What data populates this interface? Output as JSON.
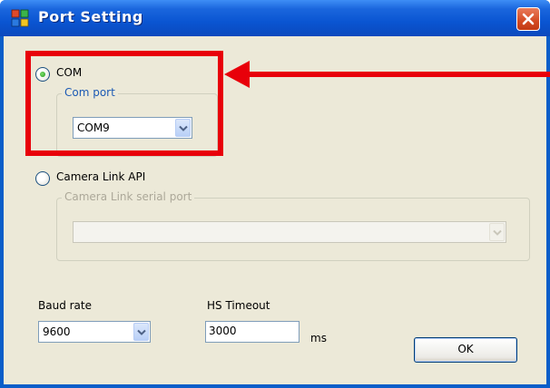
{
  "window": {
    "title": "Port Setting"
  },
  "com_option": {
    "label": "COM",
    "selected": true
  },
  "com_group": {
    "caption": "Com port",
    "selected_value": "COM9"
  },
  "camera_option": {
    "label": "Camera Link API",
    "selected": false
  },
  "camera_group": {
    "caption": "Camera Link serial port",
    "selected_value": ""
  },
  "baud": {
    "label": "Baud rate",
    "value": "9600"
  },
  "timeout": {
    "label": "HS Timeout",
    "value": "3000",
    "unit": "ms"
  },
  "buttons": {
    "ok": "OK"
  },
  "annotation": {
    "color": "#e8000a"
  },
  "colors": {
    "titlebar": "#0a55d2",
    "dialog_bg": "#ece9d8",
    "close_button": "#d44a22"
  }
}
